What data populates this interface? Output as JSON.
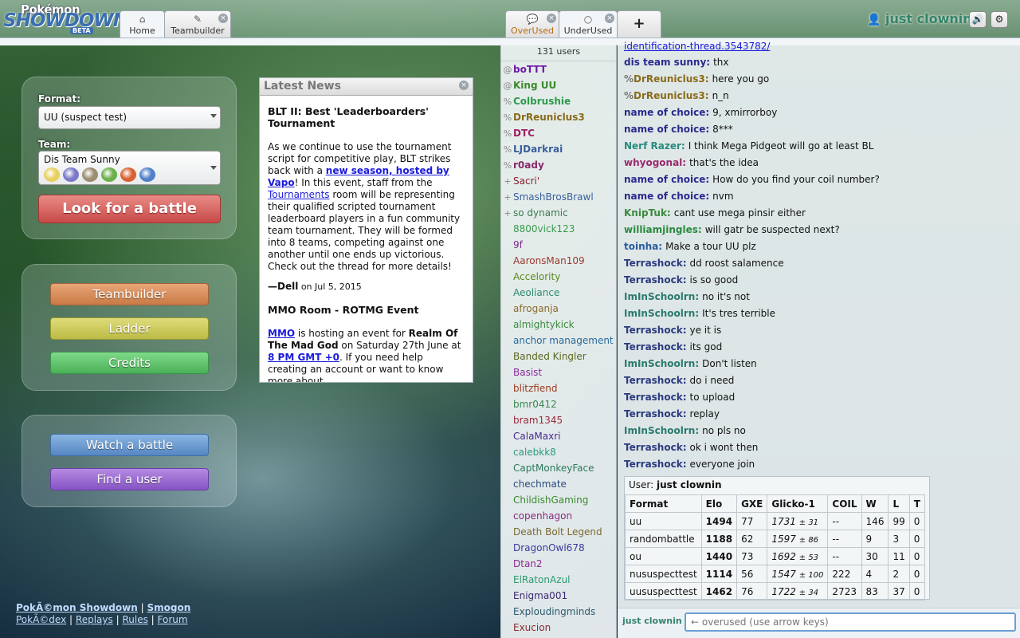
{
  "header": {
    "logo": {
      "line1": "Pokémon",
      "line2": "SHOWDOWN!",
      "badge": "BETA"
    },
    "tabs": [
      {
        "label": "Home",
        "icon": "home-icon"
      },
      {
        "label": "Teambuilder",
        "icon": "edit-icon"
      },
      {
        "label": "OverUsed",
        "icon": "chat-icon"
      },
      {
        "label": "UnderUsed",
        "icon": "chat-icon"
      },
      {
        "label": "+",
        "icon": "plus-icon"
      }
    ],
    "username": "just clownin",
    "sound_icon": "🔊",
    "settings_icon": "⚙"
  },
  "left": {
    "format_label": "Format:",
    "format_value": "UU (suspect test)",
    "team_label": "Team:",
    "team_value": "Dis Team Sunny",
    "team_pokemon_colors": [
      "#e8d060",
      "#7a7ac8",
      "#9c8c70",
      "#6ab04a",
      "#d86030",
      "#5080c8"
    ],
    "look_button": "Look for a battle",
    "teambuilder_button": "Teambuilder",
    "ladder_button": "Ladder",
    "credits_button": "Credits",
    "watch_button": "Watch a battle",
    "find_user_button": "Find a user",
    "footer": {
      "link1": "PokÃ©mon Showdown",
      "sep1": "|",
      "link2": "Smogon",
      "link3": "PokÃ©dex",
      "sep2": "|",
      "link4": "Replays",
      "sep3": "|",
      "link5": "Rules",
      "sep4": "|",
      "link6": "Forum"
    }
  },
  "news": {
    "title": "Latest News",
    "close": "×",
    "item1": {
      "headline": "BLT II: Best 'Leaderboarders' Tournament",
      "p1": "As we continue to use the tournament script for competitive play, BLT strikes back with a ",
      "link1": "new season, hosted by Vapo",
      "p2": "! In this event, staff from the ",
      "link2": "Tournaments",
      "p3": " room will be representing their qualified scripted tournament leaderboard players in a fun community team tournament. They will be formed into 8 teams, competing against one another until one ends up victorious. Check out the thread for more details!",
      "author": "—Dell",
      "date": "on Jul 5, 2015"
    },
    "item2": {
      "headline": "MMO Room - ROTMG Event",
      "link1": "MMO",
      "p1": " is hosting an event for ",
      "bold1": "Realm Of The Mad God",
      "p2": " on Saturday 27th June at ",
      "link2": "8 PM GMT +0",
      "p3": ". If you need help creating an account or want to know more about"
    }
  },
  "userlist": {
    "count": "131 users",
    "users": [
      {
        "rank": "@",
        "name": "boTTT",
        "color": "#6e1aa6",
        "staff": true
      },
      {
        "rank": "@",
        "name": "King UU",
        "color": "#3d8a2c",
        "staff": true
      },
      {
        "rank": "%",
        "name": "Colbrushie",
        "color": "#2e9a4e",
        "staff": true
      },
      {
        "rank": "%",
        "name": "DrReuniclus3",
        "color": "#8a6b1a",
        "staff": true
      },
      {
        "rank": "%",
        "name": "DTC",
        "color": "#a02066",
        "staff": true
      },
      {
        "rank": "%",
        "name": "LJDarkrai",
        "color": "#3a5f9e",
        "staff": true
      },
      {
        "rank": "%",
        "name": "r0ady",
        "color": "#8a2a6a",
        "staff": true
      },
      {
        "rank": "+",
        "name": "Sacri'",
        "color": "#8a1e2e",
        "staff": false
      },
      {
        "rank": "+",
        "name": "SmashBrosBrawl",
        "color": "#3a5f9e",
        "staff": false
      },
      {
        "rank": "+",
        "name": "so dynamic",
        "color": "#3a7a4e",
        "staff": false
      },
      {
        "rank": "",
        "name": "8800vick123",
        "color": "#3a9a4e",
        "staff": false
      },
      {
        "rank": "",
        "name": "9f",
        "color": "#7a2a8e",
        "staff": false
      },
      {
        "rank": "",
        "name": "AaronsMan109",
        "color": "#9a3a2e",
        "staff": false
      },
      {
        "rank": "",
        "name": "Accelority",
        "color": "#5a8a1e",
        "staff": false
      },
      {
        "rank": "",
        "name": "Aeoliance",
        "color": "#2a8a6e",
        "staff": false
      },
      {
        "rank": "",
        "name": "afroganja",
        "color": "#8a6a2e",
        "staff": false
      },
      {
        "rank": "",
        "name": "almightykick",
        "color": "#3a8a3e",
        "staff": false
      },
      {
        "rank": "",
        "name": "anchor management",
        "color": "#2a6a9e",
        "staff": false
      },
      {
        "rank": "",
        "name": "Banded Kingler",
        "color": "#5a6a1e",
        "staff": false
      },
      {
        "rank": "",
        "name": "Basist",
        "color": "#8a2a9e",
        "staff": false
      },
      {
        "rank": "",
        "name": "blitzfiend",
        "color": "#9a3a1e",
        "staff": false
      },
      {
        "rank": "",
        "name": "bmr0412",
        "color": "#3a8a4e",
        "staff": false
      },
      {
        "rank": "",
        "name": "bram1345",
        "color": "#9a2a3e",
        "staff": false
      },
      {
        "rank": "",
        "name": "CalaMaxri",
        "color": "#4a2a8e",
        "staff": false
      },
      {
        "rank": "",
        "name": "calebkk8",
        "color": "#2a9a7e",
        "staff": false
      },
      {
        "rank": "",
        "name": "CaptMonkeyFace",
        "color": "#2a7a5e",
        "staff": false
      },
      {
        "rank": "",
        "name": "chechmate",
        "color": "#2a4a7e",
        "staff": false
      },
      {
        "rank": "",
        "name": "ChildishGaming",
        "color": "#3a8a2e",
        "staff": false
      },
      {
        "rank": "",
        "name": "copenhagon",
        "color": "#8a2a7e",
        "staff": false
      },
      {
        "rank": "",
        "name": "Death Bolt Legend",
        "color": "#7a6a2e",
        "staff": false
      },
      {
        "rank": "",
        "name": "DragonOwl678",
        "color": "#3a3a9e",
        "staff": false
      },
      {
        "rank": "",
        "name": "Dtan2",
        "color": "#8a2a8e",
        "staff": false
      },
      {
        "rank": "",
        "name": "ElRatonAzul",
        "color": "#2a9a6e",
        "staff": false
      },
      {
        "rank": "",
        "name": "Enigma001",
        "color": "#3a2a6e",
        "staff": false
      },
      {
        "rank": "",
        "name": "Exploudingminds",
        "color": "#2a5a6e",
        "staff": false
      },
      {
        "rank": "",
        "name": "Exucion",
        "color": "#8a2a2e",
        "staff": false
      }
    ]
  },
  "chat": {
    "top_link": "identification-thread.3543782/",
    "messages": [
      {
        "rank": "",
        "name": "dis team sunny:",
        "color": "#2a2a8e",
        "text": "thx"
      },
      {
        "rank": "%",
        "name": "DrReuniclus3:",
        "color": "#8a6b1a",
        "text": "here you go"
      },
      {
        "rank": "%",
        "name": "DrReuniclus3:",
        "color": "#8a6b1a",
        "text": "n_n"
      },
      {
        "rank": "",
        "name": "name of choice:",
        "color": "#2a2a8e",
        "text": "9, xmirrorboy"
      },
      {
        "rank": "",
        "name": "name of choice:",
        "color": "#2a2a8e",
        "text": "8***"
      },
      {
        "rank": "",
        "name": "Nerf Razer:",
        "color": "#2a8a7e",
        "text": "I think Mega Pidgeot will go at least BL"
      },
      {
        "rank": "",
        "name": "whyogonal:",
        "color": "#9a2a6e",
        "text": "that's the idea"
      },
      {
        "rank": "",
        "name": "name of choice:",
        "color": "#2a2a8e",
        "text": "How do you find your coil number?"
      },
      {
        "rank": "",
        "name": "name of choice:",
        "color": "#2a2a8e",
        "text": "nvm"
      },
      {
        "rank": "",
        "name": "KnipTuk:",
        "color": "#3a8a3e",
        "text": "cant use mega pinsir either"
      },
      {
        "rank": "",
        "name": "williamjingles:",
        "color": "#2a8a3e",
        "text": "will gatr be suspected next?"
      },
      {
        "rank": "",
        "name": "toinha:",
        "color": "#2a5a9e",
        "text": "Make a tour UU plz"
      },
      {
        "rank": "",
        "name": "Terrashock:",
        "color": "#2a3a7e",
        "text": "dd roost salamence"
      },
      {
        "rank": "",
        "name": "Terrashock:",
        "color": "#2a3a7e",
        "text": "is so good"
      },
      {
        "rank": "",
        "name": "ImInSchoolrn:",
        "color": "#2a7a6e",
        "text": "no it's not"
      },
      {
        "rank": "",
        "name": "ImInSchoolrn:",
        "color": "#2a7a6e",
        "text": "It's tres terrible"
      },
      {
        "rank": "",
        "name": "Terrashock:",
        "color": "#2a3a7e",
        "text": "ye it is"
      },
      {
        "rank": "",
        "name": "Terrashock:",
        "color": "#2a3a7e",
        "text": "its god"
      },
      {
        "rank": "",
        "name": "ImInSchoolrn:",
        "color": "#2a7a6e",
        "text": "Don't listen"
      },
      {
        "rank": "",
        "name": "Terrashock:",
        "color": "#2a3a7e",
        "text": "do i need"
      },
      {
        "rank": "",
        "name": "Terrashock:",
        "color": "#2a3a7e",
        "text": "to upload"
      },
      {
        "rank": "",
        "name": "Terrashock:",
        "color": "#2a3a7e",
        "text": "replay"
      },
      {
        "rank": "",
        "name": "ImInSchoolrn:",
        "color": "#2a7a6e",
        "text": "no pls no"
      },
      {
        "rank": "",
        "name": "Terrashock:",
        "color": "#2a3a7e",
        "text": "ok i wont then"
      },
      {
        "rank": "",
        "name": "Terrashock:",
        "color": "#2a3a7e",
        "text": "everyone join"
      }
    ],
    "infobox": {
      "user_label": "User:",
      "user_name": "just clownin",
      "headers": [
        "Format",
        "Elo",
        "GXE",
        "Glicko-1",
        "COIL",
        "W",
        "L",
        "T"
      ],
      "rows": [
        {
          "format": "uu",
          "elo": "1494",
          "gxe": "77",
          "glicko": "1731",
          "dev": "± 31",
          "coil": "--",
          "w": "146",
          "l": "99",
          "t": "0"
        },
        {
          "format": "randombattle",
          "elo": "1188",
          "gxe": "62",
          "glicko": "1597",
          "dev": "± 86",
          "coil": "--",
          "w": "9",
          "l": "3",
          "t": "0"
        },
        {
          "format": "ou",
          "elo": "1440",
          "gxe": "73",
          "glicko": "1692",
          "dev": "± 53",
          "coil": "--",
          "w": "30",
          "l": "11",
          "t": "0"
        },
        {
          "format": "nususpecttest",
          "elo": "1114",
          "gxe": "56",
          "glicko": "1547",
          "dev": "± 100",
          "coil": "222",
          "w": "4",
          "l": "2",
          "t": "0"
        },
        {
          "format": "uususpecttest",
          "elo": "1462",
          "gxe": "76",
          "glicko": "1722",
          "dev": "± 34",
          "coil": "2723",
          "w": "83",
          "l": "37",
          "t": "0"
        }
      ]
    },
    "input_user": "just clownin",
    "input_placeholder": "← overused (use arrow keys)"
  }
}
